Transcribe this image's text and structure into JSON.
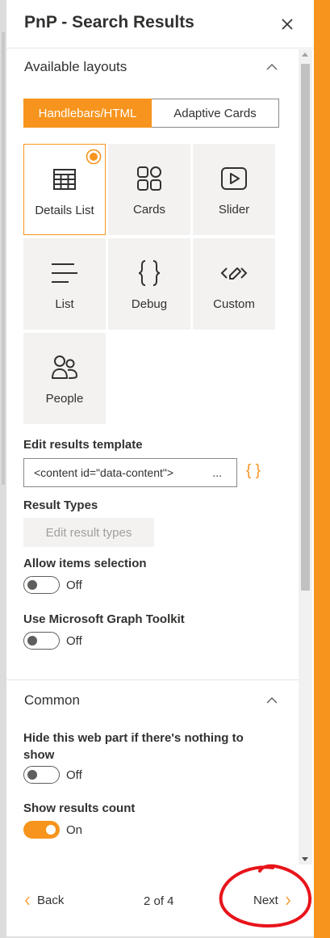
{
  "panel": {
    "title": "PnP - Search Results",
    "close_icon": "close-icon"
  },
  "layouts": {
    "title": "Available layouts",
    "tabs": [
      {
        "label": "Handlebars/HTML",
        "active": true
      },
      {
        "label": "Adaptive Cards",
        "active": false
      }
    ],
    "tiles": [
      {
        "label": "Details List",
        "icon": "table-icon",
        "selected": true
      },
      {
        "label": "Cards",
        "icon": "grid-cards-icon",
        "selected": false
      },
      {
        "label": "Slider",
        "icon": "play-slider-icon",
        "selected": false
      },
      {
        "label": "List",
        "icon": "list-lines-icon",
        "selected": false
      },
      {
        "label": "Debug",
        "icon": "braces-icon",
        "selected": false
      },
      {
        "label": "Custom",
        "icon": "code-edit-icon",
        "selected": false
      },
      {
        "label": "People",
        "icon": "people-icon",
        "selected": false
      }
    ]
  },
  "template": {
    "label": "Edit results template",
    "value": "<content id=\"data-content\">",
    "ellipsis": "...",
    "editor_icon": "{ }"
  },
  "result_types": {
    "label": "Result Types",
    "button": "Edit result types"
  },
  "allow_selection": {
    "label": "Allow items selection",
    "state": "Off"
  },
  "graph_toolkit": {
    "label": "Use Microsoft Graph Toolkit",
    "state": "Off"
  },
  "common": {
    "title": "Common",
    "hide_webpart": {
      "label": "Hide this web part if there's nothing to show",
      "state": "Off"
    },
    "show_count": {
      "label": "Show results count",
      "state": "On"
    }
  },
  "footer": {
    "back": "Back",
    "pager": "2 of 4",
    "next": "Next"
  },
  "colors": {
    "accent": "#f7941d",
    "annotation": "#e8141b"
  }
}
